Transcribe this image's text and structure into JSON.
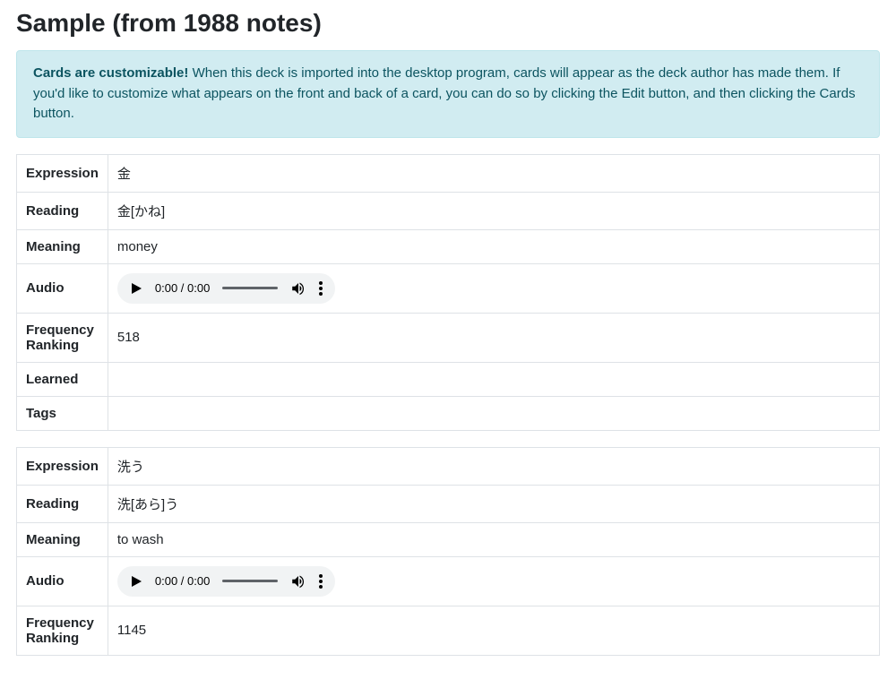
{
  "title": "Sample (from 1988 notes)",
  "alert": {
    "strong": "Cards are customizable!",
    "text": " When this deck is imported into the desktop program, cards will appear as the deck author has made them. If you'd like to customize what appears on the front and back of a card, you can do so by clicking the Edit button, and then clicking the Cards button."
  },
  "field_labels": {
    "expression": "Expression",
    "reading": "Reading",
    "meaning": "Meaning",
    "audio": "Audio",
    "frequency": "Frequency Ranking",
    "learned": "Learned",
    "tags": "Tags"
  },
  "audio_time": "0:00 / 0:00",
  "notes": [
    {
      "expression": "金",
      "reading": "金[かね]",
      "meaning": "money",
      "frequency": "518",
      "learned": "",
      "tags": ""
    },
    {
      "expression": "洗う",
      "reading": "洗[あら]う",
      "meaning": "to wash",
      "frequency": "1145",
      "learned": "",
      "tags": ""
    }
  ]
}
